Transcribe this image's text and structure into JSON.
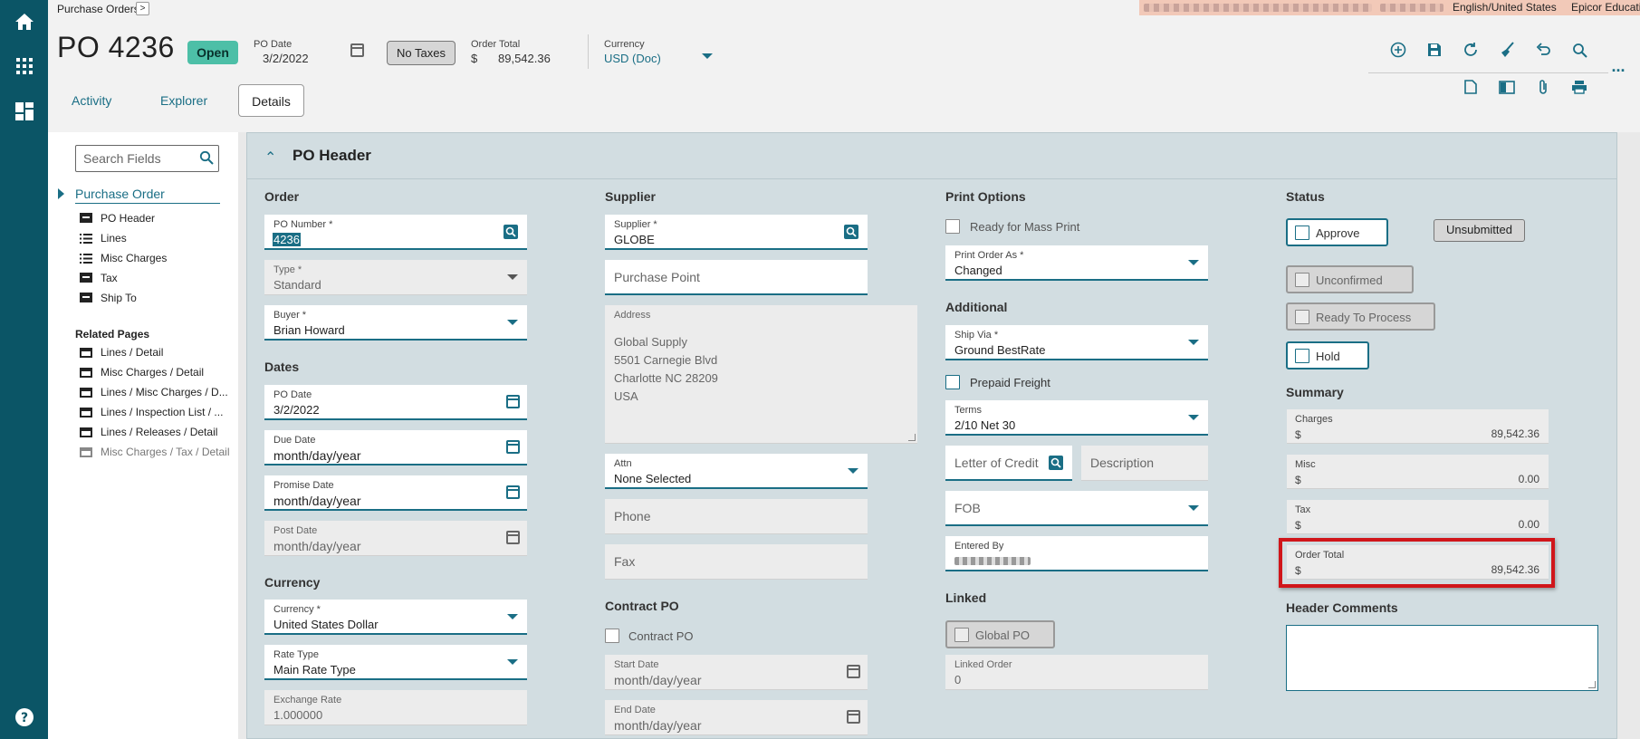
{
  "rail": {
    "icons": [
      "home-icon",
      "apps-grid-icon",
      "dashboard-icon",
      "help-icon"
    ]
  },
  "topbar": {
    "breadcrumb": "Purchase Orders",
    "chevron": ">",
    "language": "English/United States",
    "company": "Epicor Education"
  },
  "header": {
    "title": "PO 4236",
    "status": "Open",
    "po_date_label": "PO Date",
    "po_date": "3/2/2022",
    "no_taxes": "No Taxes",
    "order_total_label": "Order Total",
    "order_total_currency": "$",
    "order_total": "89,542.36",
    "currency_label": "Currency",
    "currency": "USD (Doc)"
  },
  "tabs": [
    "Activity",
    "Explorer",
    "Details"
  ],
  "toolbar": {
    "more": "..."
  },
  "sidebar": {
    "search_placeholder": "Search Fields",
    "section": "Purchase Order",
    "items": [
      "PO Header",
      "Lines",
      "Misc Charges",
      "Tax",
      "Ship To"
    ],
    "related_title": "Related Pages",
    "related": [
      "Lines / Detail",
      "Misc Charges / Detail",
      "Lines / Misc Charges / D...",
      "Lines / Inspection List / ...",
      "Lines / Releases / Detail",
      "Misc Charges / Tax / Detail"
    ]
  },
  "panel": {
    "title": "PO Header"
  },
  "order": {
    "section": "Order",
    "po_number_label": "PO Number *",
    "po_number": "4236",
    "type_label": "Type *",
    "type": "Standard",
    "buyer_label": "Buyer *",
    "buyer": "Brian Howard"
  },
  "dates": {
    "section": "Dates",
    "po_date_label": "PO Date",
    "po_date": "3/2/2022",
    "due_date_label": "Due Date",
    "due_date": "month/day/year",
    "promise_date_label": "Promise Date",
    "promise_date": "month/day/year",
    "post_date_label": "Post Date",
    "post_date": "month/day/year"
  },
  "currency": {
    "section": "Currency",
    "currency_label": "Currency *",
    "currency": "United States Dollar",
    "rate_type_label": "Rate Type",
    "rate_type": "Main Rate Type",
    "exchange_rate_label": "Exchange Rate",
    "exchange_rate": "1.000000"
  },
  "supplier": {
    "section": "Supplier",
    "supplier_label": "Supplier *",
    "supplier": "GLOBE",
    "purchase_point_ph": "Purchase Point",
    "address_label": "Address",
    "address_lines": [
      "Global Supply",
      "5501 Carnegie Blvd",
      "Charlotte NC 28209",
      "USA"
    ],
    "attn_label": "Attn",
    "attn": "None Selected",
    "phone_ph": "Phone",
    "fax_ph": "Fax"
  },
  "contract": {
    "section": "Contract PO",
    "checkbox": "Contract PO",
    "start_label": "Start Date",
    "start": "month/day/year",
    "end_label": "End Date",
    "end": "month/day/year"
  },
  "print": {
    "section": "Print Options",
    "mass_print": "Ready for Mass Print",
    "print_as_label": "Print Order As *",
    "print_as": "Changed"
  },
  "additional": {
    "section": "Additional",
    "ship_via_label": "Ship Via *",
    "ship_via": "Ground BestRate",
    "prepaid": "Prepaid Freight",
    "terms_label": "Terms",
    "terms": "2/10 Net 30",
    "loc_ph": "Letter of Credit",
    "desc_ph": "Description",
    "fob_ph": "FOB",
    "entered_by_label": "Entered By"
  },
  "linked": {
    "section": "Linked",
    "global_po": "Global PO",
    "linked_order_label": "Linked Order",
    "linked_order": "0"
  },
  "status": {
    "section": "Status",
    "approve": "Approve",
    "unsubmitted": "Unsubmitted",
    "unconfirmed": "Unconfirmed",
    "ready": "Ready To Process",
    "hold": "Hold"
  },
  "summary": {
    "section": "Summary",
    "charges_label": "Charges",
    "charges": "89,542.36",
    "misc_label": "Misc",
    "misc": "0.00",
    "tax_label": "Tax",
    "tax": "0.00",
    "total_label": "Order Total",
    "total": "89,542.36",
    "currency_symbol": "$",
    "highlight_color": "#d0161b"
  },
  "comments": {
    "section": "Header Comments"
  }
}
